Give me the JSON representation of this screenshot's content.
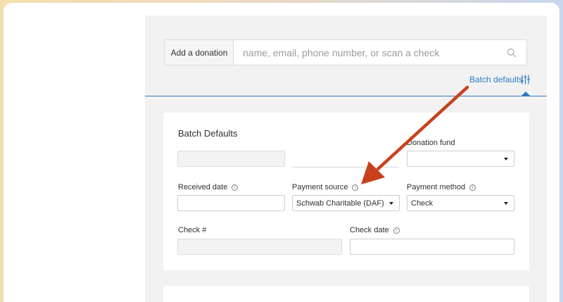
{
  "toolbar": {
    "add_donation_label": "Add a donation",
    "search_placeholder": "name, email, phone number, or scan a check",
    "batch_defaults_link": "Batch defaults"
  },
  "icons": {
    "search": "search-icon",
    "batch_defaults": "sliders-icon",
    "info": "info-icon",
    "dropdown": "caret-down-icon"
  },
  "colors": {
    "accent": "#2b7cc2",
    "annotation_arrow": "#c8411c"
  },
  "form": {
    "title": "Batch Defaults",
    "donation_fund": {
      "label": "Donation fund",
      "value": ""
    },
    "received_date": {
      "label": "Received date",
      "value": ""
    },
    "payment_source": {
      "label": "Payment source",
      "value": "Schwab Charitable (DAF)"
    },
    "payment_method": {
      "label": "Payment method",
      "value": "Check"
    },
    "check_number": {
      "label": "Check #",
      "value": ""
    },
    "check_date": {
      "label": "Check date",
      "value": ""
    }
  }
}
